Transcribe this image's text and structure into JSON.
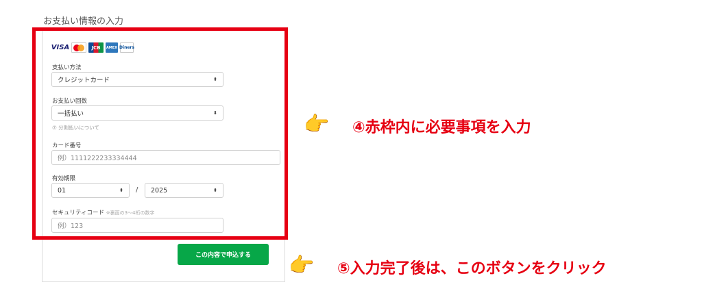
{
  "section_title": "お支払い情報の入力",
  "brands": [
    "VISA",
    "MC",
    "JCB",
    "AMEX",
    "Diners"
  ],
  "payment_method": {
    "label": "支払い方法",
    "value": "クレジットカード"
  },
  "installments": {
    "label": "お支払い回数",
    "value": "一括払い",
    "note": "⑦ 分割払いについて"
  },
  "card_number": {
    "label": "カード番号",
    "placeholder": "例）1111222233334444"
  },
  "expiry": {
    "label": "有効期限",
    "month": "01",
    "separator": "/",
    "year": "2025"
  },
  "security_code": {
    "label": "セキュリティコード",
    "hint": "※裏面の3～4桁の数字",
    "placeholder": "例）123"
  },
  "submit_label": "この内容で申込する",
  "annotations": {
    "step4": "④赤枠内に必要事項を入力",
    "step5": "⑤入力完了後は、このボタンをクリック"
  },
  "colors": {
    "frame": "#e60012",
    "button": "#07a748",
    "annotation": "#e60012"
  },
  "icons": {
    "select_arrow": "up-down-chevron-icon",
    "pointer": "pointing-hand-icon"
  }
}
